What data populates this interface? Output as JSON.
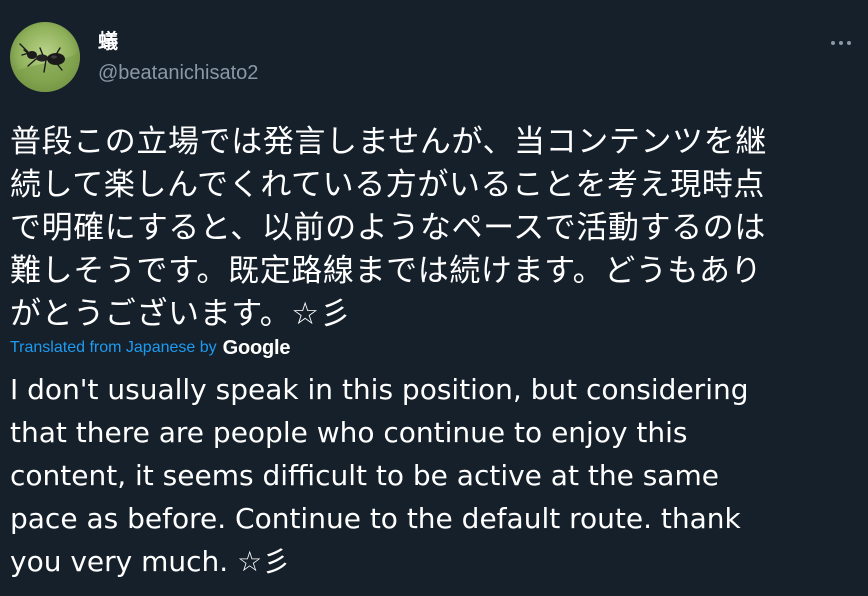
{
  "author": {
    "display_name": "蟻",
    "handle": "@beatanichisato2",
    "avatar_icon": "ant-on-leaf-avatar"
  },
  "menu": {
    "more_icon": "more-dots-icon"
  },
  "tweet": {
    "text": "普段この立場では発言しませんが、当コンテンツを継\n続して楽しんでくれている方がいることを考え現時点\nで明確にすると、以前のようなペースで活動するのは\n難しそうです。既定路線までは続けます。どうもあり\nがとうございます。☆彡"
  },
  "translation": {
    "attribution": "Translated from Japanese by",
    "provider": "Google",
    "text": "I don't usually speak in this position, but considering\nthat there are people who continue to enjoy this\ncontent, it seems difficult to be active at the same\npace as before. Continue to the default route. thank\nyou very much. ☆彡"
  },
  "colors": {
    "background": "#15202b",
    "text_primary": "#ffffff",
    "text_secondary": "#8b98a5",
    "link": "#1d9bf0"
  }
}
